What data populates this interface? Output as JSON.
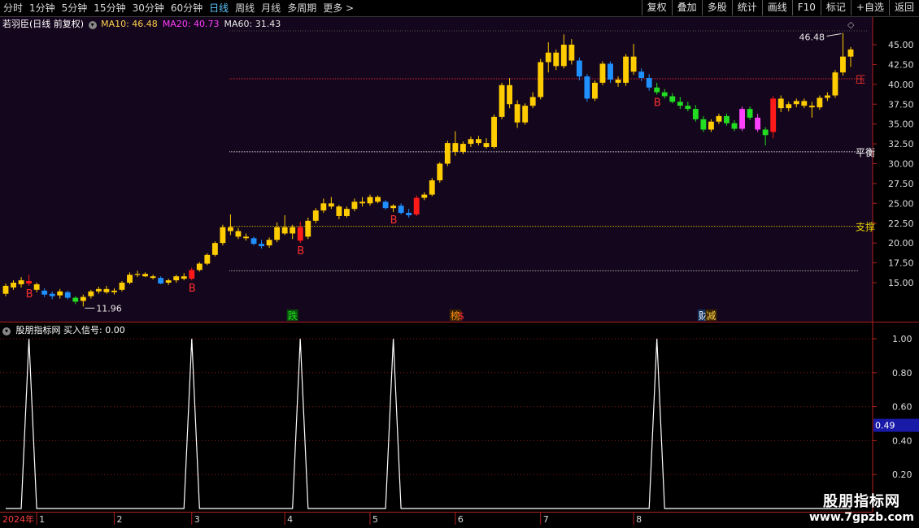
{
  "toolbar": {
    "periods": [
      "分时",
      "1分钟",
      "5分钟",
      "15分钟",
      "30分钟",
      "60分钟",
      "日线",
      "周线",
      "月线",
      "多周期",
      "更多 >"
    ],
    "active_period": "日线",
    "tools": [
      "复权",
      "叠加",
      "多股",
      "统计",
      "画线",
      "F10",
      "标记",
      "+自选",
      "返回"
    ]
  },
  "main_panel": {
    "stock_title": "若羽臣(日线 前复权)",
    "ma": [
      {
        "label": "MA10: 46.48",
        "color": "#ffd24a"
      },
      {
        "label": "MA20: 40.73",
        "color": "#ff3cff"
      },
      {
        "label": "MA60: 31.43",
        "color": "#e8e8e8"
      }
    ],
    "price_axis": [
      "45.00",
      "42.50",
      "40.00",
      "37.50",
      "35.00",
      "32.50",
      "30.00",
      "27.50",
      "25.00",
      "22.50",
      "20.00",
      "17.50",
      "15.00"
    ],
    "high_label": "46.48",
    "low_label": "11.96",
    "levels": [
      {
        "label": "压",
        "price": 40.7,
        "color": "#ff3030"
      },
      {
        "label": "平衡",
        "price": 31.5,
        "color": "#ffffff"
      },
      {
        "label": "支撑",
        "price": 22.1,
        "color": "#e8d000"
      },
      {
        "label": "",
        "price": 16.5,
        "color": "#cccccc"
      }
    ],
    "buy_marker": "B",
    "buy_days": [
      3,
      24,
      38,
      50,
      84
    ],
    "events": [
      {
        "label": "跌",
        "day": 37,
        "color": "#20e020",
        "bg": "#0a4a0a"
      },
      {
        "label": "榜",
        "day": 58,
        "color": "#ff8c1a",
        "bg": "#3a2400"
      },
      {
        "label": "$",
        "day": 59,
        "color": "#ff3030",
        "bg": ""
      },
      {
        "label": "财",
        "day": 90,
        "color": "#ffffff",
        "bg": "#103060"
      },
      {
        "label": "减",
        "day": 91,
        "color": "#ffd24a",
        "bg": "#3a2400"
      }
    ]
  },
  "sub_panel": {
    "title": "股朋指标网 买入信号: 0.00",
    "axis": [
      "1.00",
      "0.80",
      "0.60",
      "0.40",
      "0.20"
    ],
    "cursor_value": "0.49"
  },
  "date_axis": {
    "year_label": "2024年",
    "months": [
      {
        "label": "1",
        "day": 4
      },
      {
        "label": "2",
        "day": 14
      },
      {
        "label": "3",
        "day": 24
      },
      {
        "label": "4",
        "day": 36
      },
      {
        "label": "5",
        "day": 47
      },
      {
        "label": "6",
        "day": 58
      },
      {
        "label": "7",
        "day": 69
      },
      {
        "label": "8",
        "day": 81
      }
    ]
  },
  "watermark": {
    "title": "股朋指标网",
    "url": "www.7gpzb.com"
  },
  "chart_data": {
    "type": "candlestick",
    "title": "若羽臣(日线 前复权)",
    "ylim": [
      12,
      47
    ],
    "candles": [
      {
        "o": 13.6,
        "h": 14.9,
        "l": 13.3,
        "c": 14.6,
        "col": "y"
      },
      {
        "o": 14.4,
        "h": 15.3,
        "l": 14.1,
        "c": 15.0,
        "col": "y"
      },
      {
        "o": 14.8,
        "h": 15.7,
        "l": 14.4,
        "c": 15.3,
        "col": "y"
      },
      {
        "o": 15.2,
        "h": 16.0,
        "l": 14.6,
        "c": 14.9,
        "col": "r"
      },
      {
        "o": 14.8,
        "h": 15.0,
        "l": 13.8,
        "c": 14.1,
        "col": "y"
      },
      {
        "o": 14.0,
        "h": 14.3,
        "l": 13.2,
        "c": 13.5,
        "col": "b"
      },
      {
        "o": 13.6,
        "h": 13.9,
        "l": 12.9,
        "c": 13.3,
        "col": "b"
      },
      {
        "o": 13.4,
        "h": 14.2,
        "l": 13.0,
        "c": 13.9,
        "col": "y"
      },
      {
        "o": 13.8,
        "h": 14.0,
        "l": 12.9,
        "c": 13.1,
        "col": "b"
      },
      {
        "o": 13.1,
        "h": 13.3,
        "l": 12.3,
        "c": 12.6,
        "col": "g"
      },
      {
        "o": 12.7,
        "h": 13.5,
        "l": 12.0,
        "c": 13.2,
        "col": "y"
      },
      {
        "o": 13.3,
        "h": 14.1,
        "l": 13.0,
        "c": 13.9,
        "col": "y"
      },
      {
        "o": 13.9,
        "h": 14.5,
        "l": 13.6,
        "c": 14.2,
        "col": "y"
      },
      {
        "o": 14.2,
        "h": 14.6,
        "l": 13.6,
        "c": 13.8,
        "col": "y"
      },
      {
        "o": 13.8,
        "h": 14.3,
        "l": 13.5,
        "c": 14.0,
        "col": "y"
      },
      {
        "o": 14.1,
        "h": 15.2,
        "l": 13.9,
        "c": 15.0,
        "col": "y"
      },
      {
        "o": 15.0,
        "h": 16.3,
        "l": 14.8,
        "c": 16.0,
        "col": "y"
      },
      {
        "o": 16.0,
        "h": 16.5,
        "l": 15.7,
        "c": 16.1,
        "col": "y"
      },
      {
        "o": 16.1,
        "h": 16.3,
        "l": 15.7,
        "c": 15.8,
        "col": "y"
      },
      {
        "o": 15.8,
        "h": 16.0,
        "l": 15.4,
        "c": 15.6,
        "col": "y"
      },
      {
        "o": 15.6,
        "h": 15.8,
        "l": 14.8,
        "c": 14.9,
        "col": "b"
      },
      {
        "o": 15.0,
        "h": 15.5,
        "l": 14.7,
        "c": 15.3,
        "col": "y"
      },
      {
        "o": 15.3,
        "h": 16.0,
        "l": 15.0,
        "c": 15.8,
        "col": "y"
      },
      {
        "o": 15.8,
        "h": 16.2,
        "l": 15.3,
        "c": 15.5,
        "col": "y"
      },
      {
        "o": 15.5,
        "h": 16.9,
        "l": 15.3,
        "c": 16.6,
        "col": "r"
      },
      {
        "o": 16.6,
        "h": 17.6,
        "l": 16.4,
        "c": 17.4,
        "col": "y"
      },
      {
        "o": 17.4,
        "h": 18.7,
        "l": 17.2,
        "c": 18.5,
        "col": "y"
      },
      {
        "o": 18.5,
        "h": 20.2,
        "l": 18.3,
        "c": 20.0,
        "col": "y"
      },
      {
        "o": 20.0,
        "h": 22.3,
        "l": 19.7,
        "c": 22.0,
        "col": "y"
      },
      {
        "o": 22.0,
        "h": 23.6,
        "l": 21.0,
        "c": 21.5,
        "col": "y"
      },
      {
        "o": 21.5,
        "h": 21.9,
        "l": 20.5,
        "c": 20.8,
        "col": "y"
      },
      {
        "o": 20.8,
        "h": 21.2,
        "l": 20.3,
        "c": 20.6,
        "col": "y"
      },
      {
        "o": 20.6,
        "h": 20.8,
        "l": 19.7,
        "c": 19.9,
        "col": "b"
      },
      {
        "o": 19.9,
        "h": 20.4,
        "l": 19.3,
        "c": 19.6,
        "col": "b"
      },
      {
        "o": 19.7,
        "h": 20.7,
        "l": 19.4,
        "c": 20.4,
        "col": "y"
      },
      {
        "o": 20.4,
        "h": 22.6,
        "l": 20.1,
        "c": 22.0,
        "col": "y"
      },
      {
        "o": 22.0,
        "h": 23.5,
        "l": 21.0,
        "c": 21.2,
        "col": "y"
      },
      {
        "o": 21.2,
        "h": 22.3,
        "l": 20.5,
        "c": 22.0,
        "col": "y"
      },
      {
        "o": 22.0,
        "h": 22.7,
        "l": 20.0,
        "c": 20.3,
        "col": "r"
      },
      {
        "o": 20.8,
        "h": 23.2,
        "l": 20.5,
        "c": 22.8,
        "col": "y"
      },
      {
        "o": 22.8,
        "h": 24.4,
        "l": 22.5,
        "c": 24.1,
        "col": "y"
      },
      {
        "o": 24.1,
        "h": 25.6,
        "l": 23.8,
        "c": 25.0,
        "col": "y"
      },
      {
        "o": 25.0,
        "h": 25.8,
        "l": 24.3,
        "c": 24.6,
        "col": "y"
      },
      {
        "o": 24.6,
        "h": 24.8,
        "l": 23.0,
        "c": 23.4,
        "col": "y"
      },
      {
        "o": 23.4,
        "h": 24.6,
        "l": 23.2,
        "c": 24.3,
        "col": "y"
      },
      {
        "o": 24.3,
        "h": 25.6,
        "l": 24.0,
        "c": 25.2,
        "col": "y"
      },
      {
        "o": 25.2,
        "h": 25.8,
        "l": 24.6,
        "c": 25.0,
        "col": "y"
      },
      {
        "o": 25.0,
        "h": 26.1,
        "l": 24.7,
        "c": 25.8,
        "col": "y"
      },
      {
        "o": 25.8,
        "h": 26.0,
        "l": 25.0,
        "c": 25.2,
        "col": "y"
      },
      {
        "o": 25.2,
        "h": 25.4,
        "l": 24.2,
        "c": 24.4,
        "col": "b"
      },
      {
        "o": 24.4,
        "h": 24.9,
        "l": 23.9,
        "c": 24.7,
        "col": "y"
      },
      {
        "o": 24.7,
        "h": 25.0,
        "l": 23.6,
        "c": 23.8,
        "col": "b"
      },
      {
        "o": 23.8,
        "h": 24.3,
        "l": 23.2,
        "c": 23.5,
        "col": "b"
      },
      {
        "o": 23.6,
        "h": 26.0,
        "l": 23.4,
        "c": 25.7,
        "col": "r"
      },
      {
        "o": 25.7,
        "h": 26.4,
        "l": 25.4,
        "c": 26.1,
        "col": "y"
      },
      {
        "o": 26.1,
        "h": 28.2,
        "l": 25.9,
        "c": 27.9,
        "col": "y"
      },
      {
        "o": 27.9,
        "h": 30.2,
        "l": 27.6,
        "c": 30.0,
        "col": "y"
      },
      {
        "o": 30.0,
        "h": 32.9,
        "l": 29.7,
        "c": 32.6,
        "col": "y"
      },
      {
        "o": 32.6,
        "h": 34.1,
        "l": 31.0,
        "c": 31.5,
        "col": "y"
      },
      {
        "o": 31.5,
        "h": 32.8,
        "l": 31.2,
        "c": 32.5,
        "col": "y"
      },
      {
        "o": 32.5,
        "h": 33.4,
        "l": 32.1,
        "c": 33.1,
        "col": "y"
      },
      {
        "o": 33.1,
        "h": 33.5,
        "l": 32.3,
        "c": 32.6,
        "col": "y"
      },
      {
        "o": 32.6,
        "h": 33.2,
        "l": 31.9,
        "c": 32.1,
        "col": "y"
      },
      {
        "o": 32.1,
        "h": 36.2,
        "l": 31.9,
        "c": 35.9,
        "col": "y"
      },
      {
        "o": 35.9,
        "h": 40.2,
        "l": 35.6,
        "c": 39.9,
        "col": "y"
      },
      {
        "o": 39.9,
        "h": 40.8,
        "l": 37.0,
        "c": 37.5,
        "col": "y"
      },
      {
        "o": 37.5,
        "h": 38.0,
        "l": 34.5,
        "c": 35.2,
        "col": "y"
      },
      {
        "o": 35.2,
        "h": 37.6,
        "l": 34.9,
        "c": 37.3,
        "col": "y"
      },
      {
        "o": 37.3,
        "h": 39.0,
        "l": 37.0,
        "c": 38.4,
        "col": "y"
      },
      {
        "o": 38.4,
        "h": 43.2,
        "l": 38.1,
        "c": 42.8,
        "col": "y"
      },
      {
        "o": 42.8,
        "h": 45.3,
        "l": 41.5,
        "c": 44.0,
        "col": "y"
      },
      {
        "o": 44.0,
        "h": 44.4,
        "l": 41.8,
        "c": 42.3,
        "col": "y"
      },
      {
        "o": 42.3,
        "h": 46.3,
        "l": 42.0,
        "c": 45.0,
        "col": "y"
      },
      {
        "o": 45.0,
        "h": 45.7,
        "l": 42.5,
        "c": 43.0,
        "col": "y"
      },
      {
        "o": 43.0,
        "h": 43.4,
        "l": 40.5,
        "c": 41.0,
        "col": "b"
      },
      {
        "o": 41.0,
        "h": 41.3,
        "l": 37.8,
        "c": 38.2,
        "col": "b"
      },
      {
        "o": 38.2,
        "h": 40.5,
        "l": 37.9,
        "c": 40.2,
        "col": "y"
      },
      {
        "o": 40.2,
        "h": 42.9,
        "l": 39.9,
        "c": 42.6,
        "col": "y"
      },
      {
        "o": 42.6,
        "h": 42.9,
        "l": 40.2,
        "c": 40.6,
        "col": "b"
      },
      {
        "o": 40.6,
        "h": 41.0,
        "l": 39.7,
        "c": 40.2,
        "col": "y"
      },
      {
        "o": 40.2,
        "h": 43.8,
        "l": 39.8,
        "c": 43.5,
        "col": "y"
      },
      {
        "o": 43.5,
        "h": 45.1,
        "l": 41.2,
        "c": 41.6,
        "col": "y"
      },
      {
        "o": 41.6,
        "h": 42.0,
        "l": 40.4,
        "c": 40.8,
        "col": "b"
      },
      {
        "o": 40.8,
        "h": 41.3,
        "l": 39.2,
        "c": 39.6,
        "col": "b"
      },
      {
        "o": 39.6,
        "h": 40.2,
        "l": 38.7,
        "c": 39.0,
        "col": "g"
      },
      {
        "o": 39.0,
        "h": 39.4,
        "l": 38.2,
        "c": 38.5,
        "col": "g"
      },
      {
        "o": 38.5,
        "h": 38.9,
        "l": 37.6,
        "c": 37.8,
        "col": "g"
      },
      {
        "o": 37.8,
        "h": 38.4,
        "l": 36.9,
        "c": 37.3,
        "col": "g"
      },
      {
        "o": 37.3,
        "h": 37.8,
        "l": 36.6,
        "c": 36.9,
        "col": "g"
      },
      {
        "o": 36.9,
        "h": 37.4,
        "l": 35.3,
        "c": 35.6,
        "col": "g"
      },
      {
        "o": 35.6,
        "h": 36.0,
        "l": 34.0,
        "c": 34.3,
        "col": "g"
      },
      {
        "o": 34.3,
        "h": 35.6,
        "l": 34.0,
        "c": 35.3,
        "col": "y"
      },
      {
        "o": 35.3,
        "h": 36.3,
        "l": 35.0,
        "c": 36.0,
        "col": "y"
      },
      {
        "o": 36.0,
        "h": 36.3,
        "l": 34.8,
        "c": 35.1,
        "col": "g"
      },
      {
        "o": 35.1,
        "h": 35.5,
        "l": 34.1,
        "c": 34.4,
        "col": "g"
      },
      {
        "o": 34.4,
        "h": 37.2,
        "l": 34.1,
        "c": 36.9,
        "col": "m"
      },
      {
        "o": 36.9,
        "h": 37.2,
        "l": 35.5,
        "c": 35.8,
        "col": "g"
      },
      {
        "o": 35.8,
        "h": 36.3,
        "l": 34.0,
        "c": 34.3,
        "col": "m"
      },
      {
        "o": 34.3,
        "h": 34.6,
        "l": 32.3,
        "c": 33.6,
        "col": "g"
      },
      {
        "o": 34.0,
        "h": 38.5,
        "l": 33.2,
        "c": 38.2,
        "col": "r"
      },
      {
        "o": 38.2,
        "h": 38.6,
        "l": 36.5,
        "c": 37.0,
        "col": "y"
      },
      {
        "o": 37.0,
        "h": 37.8,
        "l": 36.6,
        "c": 37.5,
        "col": "y"
      },
      {
        "o": 37.5,
        "h": 38.2,
        "l": 37.1,
        "c": 37.9,
        "col": "y"
      },
      {
        "o": 37.9,
        "h": 38.2,
        "l": 37.0,
        "c": 37.3,
        "col": "y"
      },
      {
        "o": 37.3,
        "h": 37.8,
        "l": 35.8,
        "c": 37.1,
        "col": "y"
      },
      {
        "o": 37.1,
        "h": 38.6,
        "l": 36.8,
        "c": 38.3,
        "col": "y"
      },
      {
        "o": 38.3,
        "h": 39.0,
        "l": 37.9,
        "c": 38.6,
        "col": "y"
      },
      {
        "o": 38.6,
        "h": 41.8,
        "l": 38.3,
        "c": 41.5,
        "col": "y"
      },
      {
        "o": 41.5,
        "h": 46.48,
        "l": 41.1,
        "c": 43.5,
        "col": "y"
      },
      {
        "o": 43.5,
        "h": 44.7,
        "l": 42.2,
        "c": 44.4,
        "col": "y"
      }
    ],
    "signal": [
      {
        "day": 3,
        "value": 1.0
      },
      {
        "day": 24,
        "value": 1.0
      },
      {
        "day": 38,
        "value": 1.0
      },
      {
        "day": 50,
        "value": 1.0
      },
      {
        "day": 84,
        "value": 1.0
      }
    ]
  }
}
